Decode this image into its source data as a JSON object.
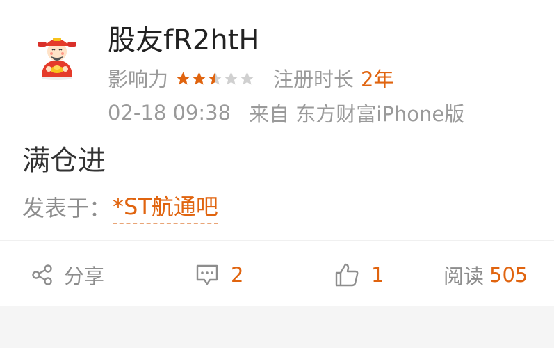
{
  "post": {
    "username": "股友fR2htH",
    "influence_label": "影响力",
    "influence_rating": 2.5,
    "influence_max": 5,
    "register_label": "注册时长",
    "register_value": "2年",
    "timestamp": "02-18 09:38",
    "source": "来自 东方财富iPhone版",
    "content": "满仓进",
    "posted_label": "发表于：",
    "forum": "*ST航通吧"
  },
  "actions": {
    "share_label": "分享",
    "comment_count": "2",
    "like_count": "1",
    "read_label": "阅读",
    "read_count": "505"
  },
  "colors": {
    "accent": "#e0640f",
    "muted": "#9a9a9a",
    "star_off": "#d0d0d0"
  },
  "icons": {
    "avatar": "cartoon-god-of-wealth-avatar",
    "share": "share-icon",
    "comment": "comment-icon",
    "like": "thumbs-up-icon"
  }
}
